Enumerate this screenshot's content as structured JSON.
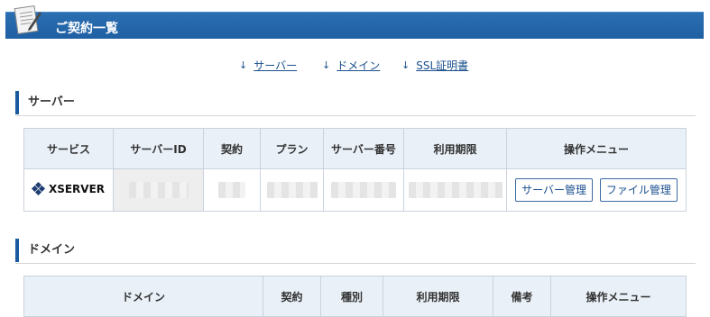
{
  "header": {
    "title": "ご契約一覧"
  },
  "anchors": [
    {
      "label": "サーバー",
      "arrow": "↓"
    },
    {
      "label": "ドメイン",
      "arrow": "↓"
    },
    {
      "label": "SSL証明書",
      "arrow": "↓"
    }
  ],
  "server_section": {
    "title": "サーバー",
    "columns": [
      "サービス",
      "サーバーID",
      "契約",
      "プラン",
      "サーバー番号",
      "利用期限",
      "操作メニュー"
    ],
    "row": {
      "service": "XSERVER",
      "buttons": [
        "サーバー管理",
        "ファイル管理"
      ]
    }
  },
  "domain_section": {
    "title": "ドメイン",
    "columns": [
      "ドメイン",
      "契約",
      "種別",
      "利用期限",
      "備考",
      "操作メニュー"
    ]
  },
  "colors": {
    "header_bg": "#1f5fa3",
    "accent": "#1a5aa1",
    "link": "#1a4f8d",
    "table_head_bg": "#e9f0f7"
  }
}
